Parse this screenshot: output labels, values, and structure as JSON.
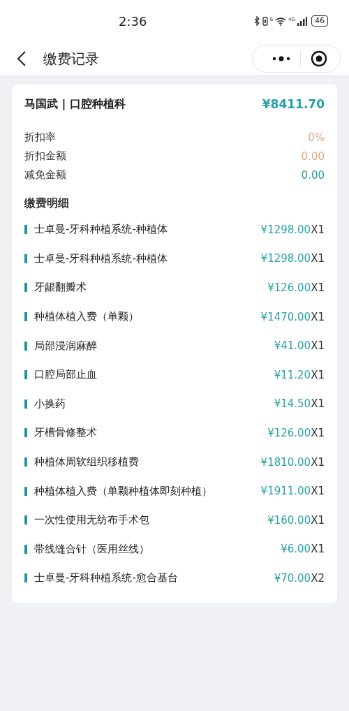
{
  "status_bar": {
    "time": "2:36",
    "wifi_label": "6",
    "network": "4G",
    "battery": "46"
  },
  "nav_bar": {
    "title": "缴费记录"
  },
  "record": {
    "title": "马国武 | 口腔种植科",
    "total": "¥8411.70",
    "summary": [
      {
        "label": "折扣率",
        "value": "0%",
        "color": "#e3a67e"
      },
      {
        "label": "折扣金额",
        "value": "0.00",
        "color": "#e3a67e"
      },
      {
        "label": "减免金额",
        "value": "0.00",
        "color": "#2a9ba3"
      }
    ],
    "details_title": "缴费明细",
    "items": [
      {
        "name": "士卓曼-牙科种植系统-种植体",
        "price": "¥1298.00",
        "qty": "X1"
      },
      {
        "name": "士卓曼-牙科种植系统-种植体",
        "price": "¥1298.00",
        "qty": "X1"
      },
      {
        "name": "牙龈翻瓣术",
        "price": "¥126.00",
        "qty": "X1"
      },
      {
        "name": "种植体植入费（单颗）",
        "price": "¥1470.00",
        "qty": "X1"
      },
      {
        "name": "局部浸润麻醉",
        "price": "¥41.00",
        "qty": "X1"
      },
      {
        "name": "口腔局部止血",
        "price": "¥11.20",
        "qty": "X1"
      },
      {
        "name": "小换药",
        "price": "¥14.50",
        "qty": "X1"
      },
      {
        "name": "牙槽骨修整术",
        "price": "¥126.00",
        "qty": "X1"
      },
      {
        "name": "种植体周软组织移植费",
        "price": "¥1810.00",
        "qty": "X1"
      },
      {
        "name": "种植体植入费（单颗种植体即刻种植）",
        "price": "¥1911.00",
        "qty": "X1"
      },
      {
        "name": "一次性使用无纺布手术包",
        "price": "¥160.00",
        "qty": "X1"
      },
      {
        "name": "带线缝合针（医用丝线）",
        "price": "¥6.00",
        "qty": "X1"
      },
      {
        "name": "士卓曼-牙科种植系统-愈合基台",
        "price": "¥70.00",
        "qty": "X2"
      }
    ]
  }
}
